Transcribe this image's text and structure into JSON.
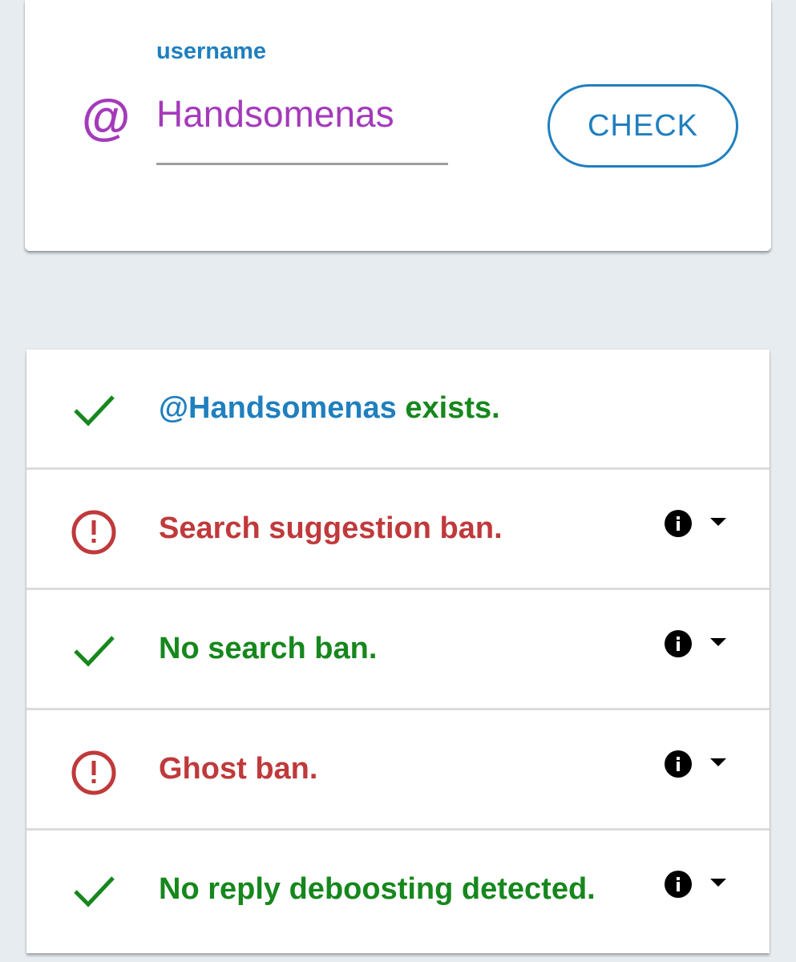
{
  "username_card": {
    "label": "username",
    "at_symbol": "@",
    "value": "Handsomenas",
    "button_label": "CHECK"
  },
  "results": [
    {
      "status": "ok",
      "icon": "check-icon",
      "handle": "@Handsomenas",
      "text": " exists.",
      "has_info": false
    },
    {
      "status": "bad",
      "icon": "alert-circle-icon",
      "text": "Search suggestion ban.",
      "has_info": true
    },
    {
      "status": "ok",
      "icon": "check-icon",
      "text": "No search ban.",
      "has_info": true
    },
    {
      "status": "bad",
      "icon": "alert-circle-icon",
      "text": "Ghost ban.",
      "has_info": true
    },
    {
      "status": "ok",
      "icon": "check-icon",
      "text": "No reply deboosting detected.",
      "has_info": true
    }
  ],
  "colors": {
    "ok": "#16871d",
    "bad": "#c0393b",
    "accent": "#1f7fbf",
    "username": "#a43aba",
    "background": "#e7ecf0"
  }
}
